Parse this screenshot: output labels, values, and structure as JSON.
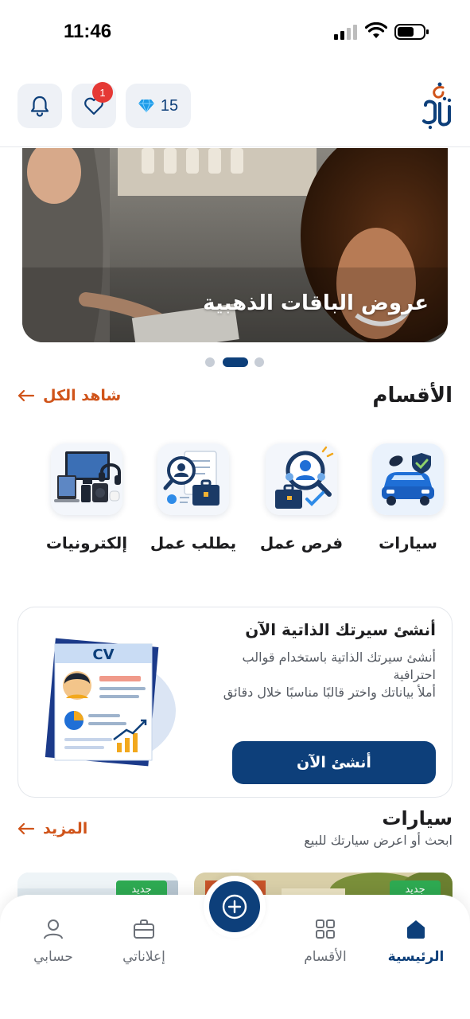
{
  "status_bar": {
    "time": "11:46"
  },
  "header": {
    "notification_badge": "1",
    "gems_count": "15"
  },
  "banner": {
    "title": "عروض الباقات الذهبية",
    "active_slide": 2,
    "total_slides": 3
  },
  "categories_section": {
    "title": "الأقسام",
    "see_all": "شاهد الكل",
    "items": [
      {
        "label": "سيارات",
        "icon": "car-icon"
      },
      {
        "label": "فرص عمل",
        "icon": "job-search-icon"
      },
      {
        "label": "يطلب عمل",
        "icon": "resume-briefcase-icon"
      },
      {
        "label": "إلكترونيات",
        "icon": "electronics-icon"
      }
    ]
  },
  "cv_card": {
    "title": "أنشئ سيرتك الذاتية الآن",
    "desc_line1": "أنشئ سيرتك الذاتية باستخدام قوالب احترافية",
    "desc_line2": "أملأ بياناتك واختر قالبًا مناسبًا خلال دقائق",
    "button": "أنشئ الآن",
    "illus_label": "CV"
  },
  "cars_section": {
    "title": "سيارات",
    "subtitle": "ابحث أو اعرض سيارتك للبيع",
    "more": "المزيد",
    "new_tag": "جديد"
  },
  "bottom_nav": {
    "items": [
      {
        "label": "الرئيسية",
        "icon": "home-icon",
        "active": true
      },
      {
        "label": "الأقسام",
        "icon": "grid-icon",
        "active": false
      },
      {
        "label": "إعلاناتي",
        "icon": "briefcase-icon",
        "active": false
      },
      {
        "label": "حسابي",
        "icon": "user-icon",
        "active": false
      }
    ],
    "fab_icon": "plus-circle-icon"
  },
  "colors": {
    "brand": "#0d3f7a",
    "accent": "#d0541a",
    "badge": "#e53935",
    "new_tag": "#2eaa52"
  }
}
